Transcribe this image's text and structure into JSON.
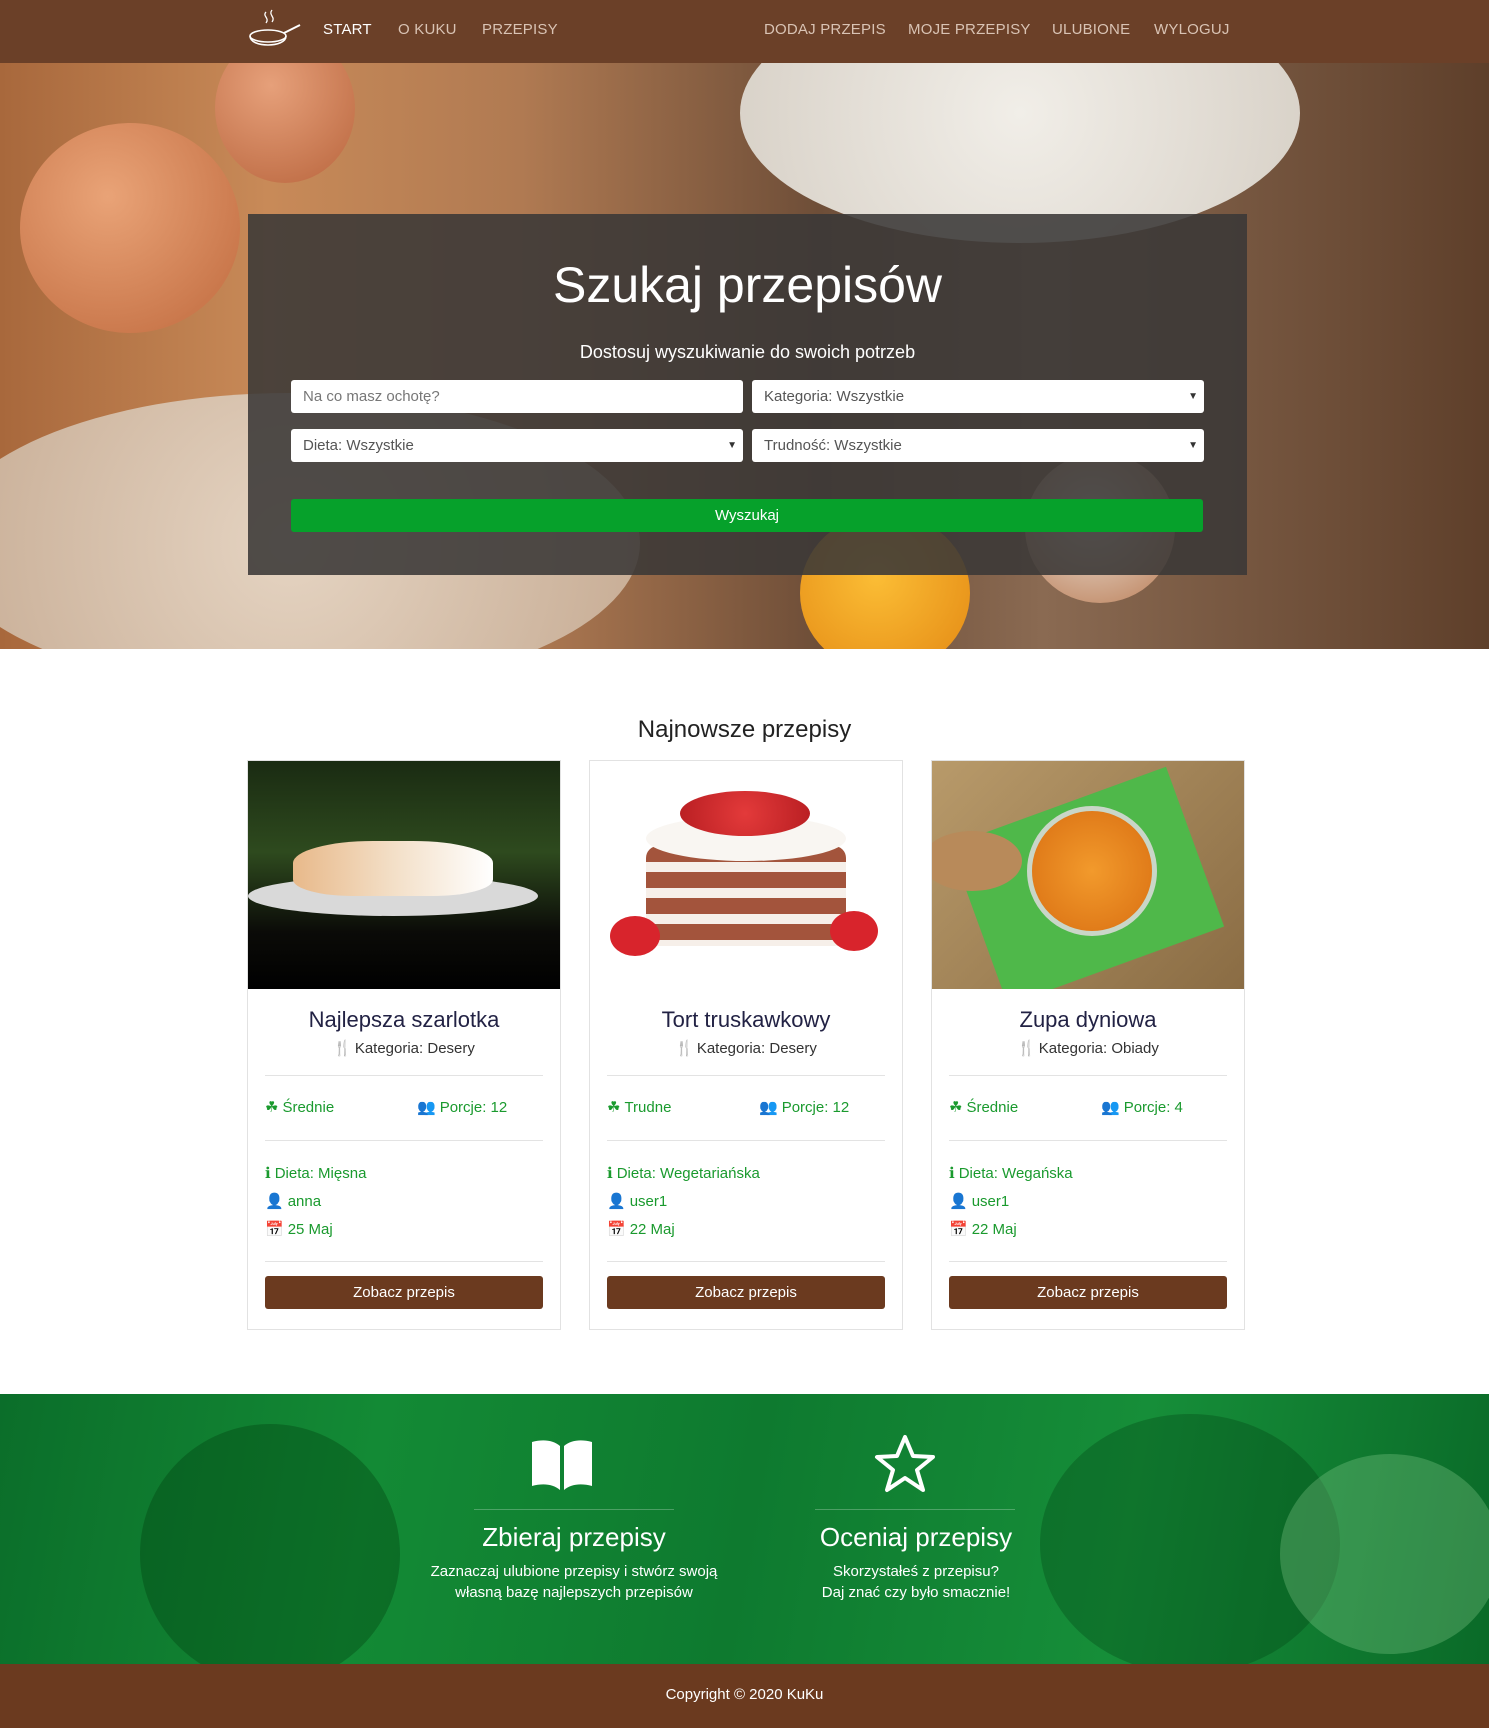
{
  "nav": {
    "left": [
      "START",
      "O KUKU",
      "PRZEPISY"
    ],
    "right": [
      "DODAJ PRZEPIS",
      "MOJE PRZEPISY",
      "ULUBIONE",
      "WYLOGUJ"
    ]
  },
  "hero": {
    "title": "Szukaj przepisów",
    "subtitle": "Dostosuj wyszukiwanie do swoich potrzeb",
    "search_placeholder": "Na co masz ochotę?",
    "category_select": "Kategoria: Wszystkie",
    "diet_select": "Dieta: Wszystkie",
    "difficulty_select": "Trudność: Wszystkie",
    "search_button": "Wyszukaj"
  },
  "latest": {
    "title": "Najnowsze przepisy",
    "cards": [
      {
        "title": "Najlepsza szarlotka",
        "category": "Kategoria: Desery",
        "difficulty": "Średnie",
        "portions": "Porcje: 12",
        "diet": "Dieta: Mięsna",
        "author": "anna",
        "date": "25 Maj",
        "button": "Zobacz przepis"
      },
      {
        "title": "Tort truskawkowy",
        "category": "Kategoria: Desery",
        "difficulty": "Trudne",
        "portions": "Porcje: 12",
        "diet": "Dieta: Wegetariańska",
        "author": "user1",
        "date": "22 Maj",
        "button": "Zobacz przepis"
      },
      {
        "title": "Zupa dyniowa",
        "category": "Kategoria: Obiady",
        "difficulty": "Średnie",
        "portions": "Porcje: 4",
        "diet": "Dieta: Wegańska",
        "author": "user1",
        "date": "22 Maj",
        "button": "Zobacz przepis"
      }
    ]
  },
  "features": [
    {
      "icon": "book-icon",
      "title": "Zbieraj przepisy",
      "text_line1": "Zaznaczaj ulubione przepisy i stwórz swoją",
      "text_line2": "własną bazę najlepszych przepisów"
    },
    {
      "icon": "star-icon",
      "title": "Oceniaj przepisy",
      "text_line1": "Skorzystałeś z przepisu?",
      "text_line2": "Daj znać czy było smacznie!"
    }
  ],
  "footer": {
    "copyright": "Copyright © 2020 KuKu"
  },
  "colors": {
    "brown": "#6b4028",
    "button_brown": "#6b3a1f",
    "green": "#06a12b",
    "icon_green": "#1a9a2e"
  }
}
